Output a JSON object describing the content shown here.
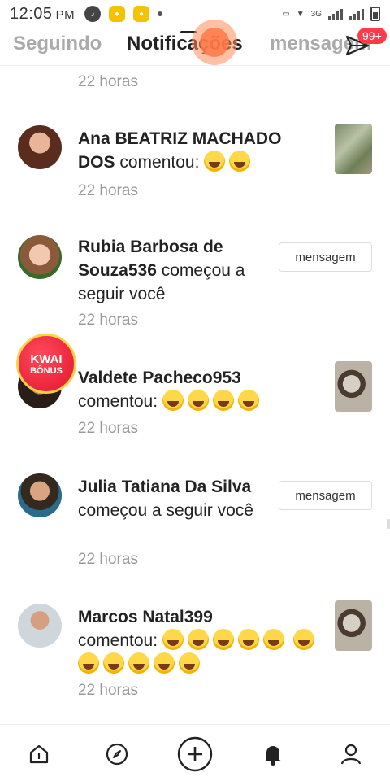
{
  "status_bar": {
    "time": "12:05",
    "ampm": "PM",
    "network": "3G"
  },
  "tabs": {
    "following": "Seguindo",
    "notifications": "Notificações",
    "messages": "mensagem",
    "message_badge": "99+"
  },
  "feed": {
    "top_time": "22 horas",
    "items": [
      {
        "name": "Ana BEATRIZ MACHADO DOS",
        "action": "comentou:",
        "emoji_count": 2,
        "time": "22 horas"
      },
      {
        "name": "Rubia Barbosa de Souza536",
        "action": "começou a seguir você",
        "button": "mensagem",
        "time": "22 horas"
      },
      {
        "name": "Valdete Pacheco953",
        "action": "comentou:",
        "emoji_count": 4,
        "time": "22 horas"
      },
      {
        "name": "Julia Tatiana Da Silva",
        "action": "começou a seguir você",
        "button": "mensagem",
        "time": "22 horas"
      },
      {
        "name": "Marcos Natal399",
        "action": "comentou:",
        "emoji_count": 11,
        "time": "22 horas"
      }
    ]
  },
  "kwai_bonus": {
    "title": "KWAI",
    "subtitle": "BÔNUS"
  },
  "colors": {
    "badge": "#ff3b4a",
    "kwai": "#e2142e",
    "text": "#222222",
    "muted": "#999999"
  },
  "icons": [
    "home-icon",
    "discover-icon",
    "plus-icon",
    "bell-icon",
    "profile-icon",
    "send-icon"
  ]
}
